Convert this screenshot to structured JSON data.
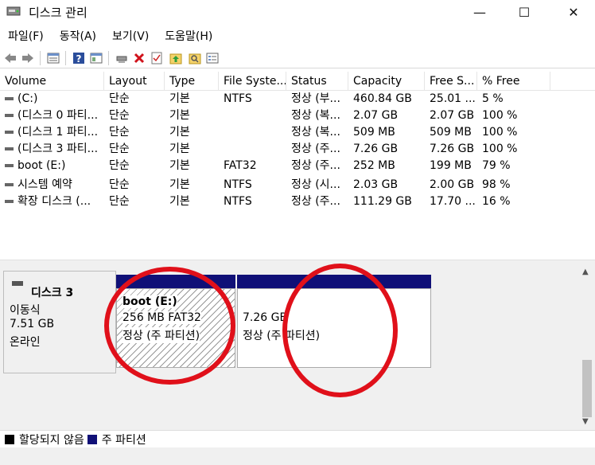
{
  "window": {
    "title": "디스크 관리",
    "controls": {
      "minimize": "—",
      "maximize": "☐",
      "close": "✕"
    }
  },
  "menu": [
    "파일(F)",
    "동작(A)",
    "보기(V)",
    "도움말(H)"
  ],
  "toolbar": {
    "icons": [
      "back-icon",
      "forward-icon",
      "disk-list-icon",
      "help-icon",
      "properties-icon",
      "connect-icon",
      "delete-icon",
      "checklist-icon",
      "upload-icon",
      "search-icon",
      "view-icon"
    ]
  },
  "table": {
    "columns": [
      "Volume",
      "Layout",
      "Type",
      "File Syste...",
      "Status",
      "Capacity",
      "Free S...",
      "% Free"
    ],
    "rows": [
      [
        "(C:)",
        "단순",
        "기본",
        "NTFS",
        "정상 (부...",
        "460.84 GB",
        "25.01 ...",
        "5 %"
      ],
      [
        "(디스크 0 파티...",
        "단순",
        "기본",
        "",
        "정상 (복...",
        "2.07 GB",
        "2.07 GB",
        "100 %"
      ],
      [
        "(디스크 1 파티...",
        "단순",
        "기본",
        "",
        "정상 (복...",
        "509 MB",
        "509 MB",
        "100 %"
      ],
      [
        "(디스크 3 파티...",
        "단순",
        "기본",
        "",
        "정상 (주...",
        "7.26 GB",
        "7.26 GB",
        "100 %"
      ],
      [
        "boot (E:)",
        "단순",
        "기본",
        "FAT32",
        "정상 (주...",
        "252 MB",
        "199 MB",
        "79 %"
      ],
      [
        "시스템 예약",
        "단순",
        "기본",
        "NTFS",
        "정상 (시...",
        "2.03 GB",
        "2.00 GB",
        "98 %"
      ],
      [
        "확장 디스크 (...",
        "단순",
        "기본",
        "NTFS",
        "정상 (주...",
        "111.29 GB",
        "17.70 ...",
        "16 %"
      ]
    ]
  },
  "disk": {
    "name": "디스크 3",
    "type": "이동식",
    "size": "7.51 GB",
    "state": "온라인"
  },
  "partitions": [
    {
      "name": "boot  (E:)",
      "size_fs": "256 MB FAT32",
      "status": "정상 (주 파티션)"
    },
    {
      "name": "",
      "size_fs": "7.26 GB",
      "status": "정상 (주 파티션)"
    }
  ],
  "legend": [
    {
      "label": "할당되지 않음",
      "color": "#000000"
    },
    {
      "label": "주 파티션",
      "color": "#101077"
    }
  ],
  "annotation_color": "#e0101a"
}
